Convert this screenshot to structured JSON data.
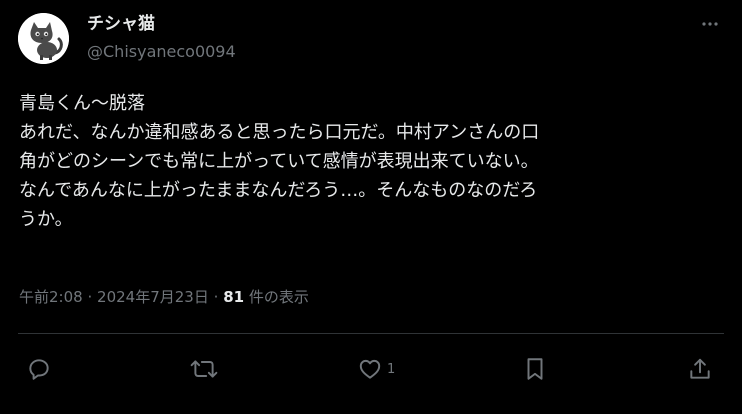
{
  "author": {
    "display_name": "チシャ猫",
    "handle": "@Chisyaneco0094"
  },
  "post": {
    "lines": [
      "青島くん〜脱落",
      "あれだ、なんか違和感あると思ったら口元だ。中村アンさんの口",
      "角がどのシーンでも常に上がっていて感情が表現出来ていない。",
      "なんであんなに上がったままなんだろう…。そんなものなのだろ",
      "うか。"
    ]
  },
  "meta": {
    "time": "午前2:08",
    "separator": "·",
    "date": "2024年7月23日",
    "views_count": "81",
    "views_label": " 件の表示"
  },
  "actions": {
    "reply_icon": "reply-icon",
    "repost_icon": "repost-icon",
    "like_icon": "heart-icon",
    "like_count": "1",
    "bookmark_icon": "bookmark-icon",
    "share_icon": "share-icon"
  },
  "colors": {
    "background": "#000000",
    "primary_text": "#e7e9ea",
    "secondary_text": "#71767b",
    "divider": "#2f3336"
  }
}
